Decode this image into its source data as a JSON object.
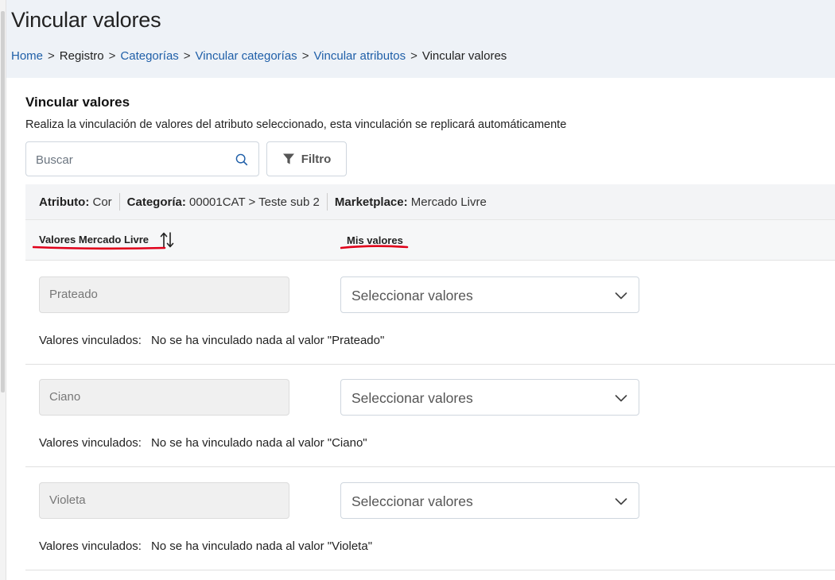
{
  "page": {
    "title": "Vincular valores",
    "breadcrumb": [
      {
        "label": "Home",
        "link": true
      },
      {
        "label": "Registro",
        "link": false
      },
      {
        "label": "Categorías",
        "link": true
      },
      {
        "label": "Vincular categorías",
        "link": true
      },
      {
        "label": "Vincular atributos",
        "link": true
      },
      {
        "label": "Vincular valores",
        "link": false
      }
    ],
    "breadcrumb_separator": ">"
  },
  "section": {
    "title": "Vincular valores",
    "description": "Realiza la vinculación de valores del atributo seleccionado, esta vinculación se replicará automáticamente"
  },
  "toolbar": {
    "search_placeholder": "Buscar",
    "filter_label": "Filtro"
  },
  "info": {
    "attribute_label": "Atributo:",
    "attribute_value": "Cor",
    "category_label": "Categoría:",
    "category_value": "00001CAT > Teste sub 2",
    "marketplace_label": "Marketplace:",
    "marketplace_value": "Mercado Livre"
  },
  "columns": {
    "ml_values": "Valores Mercado Livre",
    "my_values": "Mis valores"
  },
  "colors": {
    "link": "#1f5fa8",
    "annotation_underline": "#e0001a",
    "header_bg": "#eef2f7"
  },
  "rows": [
    {
      "ml_value": "Prateado",
      "select_placeholder": "Seleccionar valores",
      "linked_label": "Valores vinculados:",
      "linked_text": "No se ha vinculado nada al valor \"Prateado\""
    },
    {
      "ml_value": "Ciano",
      "select_placeholder": "Seleccionar valores",
      "linked_label": "Valores vinculados:",
      "linked_text": "No se ha vinculado nada al valor \"Ciano\""
    },
    {
      "ml_value": "Violeta",
      "select_placeholder": "Seleccionar valores",
      "linked_label": "Valores vinculados:",
      "linked_text": "No se ha vinculado nada al valor \"Violeta\""
    }
  ]
}
